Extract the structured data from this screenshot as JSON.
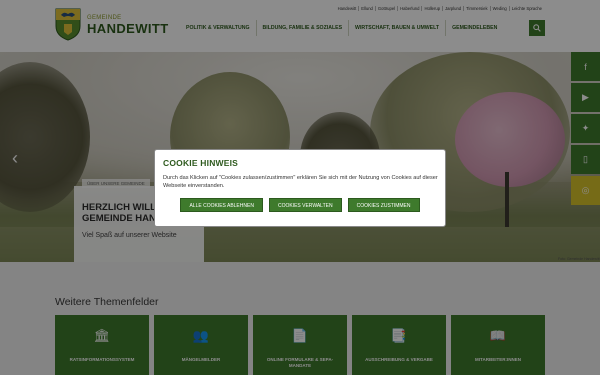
{
  "header": {
    "logo_small": "GEMEINDE",
    "logo_big": "HANDEWITT",
    "quicklinks": [
      "Handewitt",
      "Ellund",
      "Gottrupel",
      "Haberlund",
      "Hüllerup",
      "Jarplund",
      "Timmersiek",
      "Weding",
      "Leichte Sprache"
    ],
    "nav": [
      "POLITIK & VERWALTUNG",
      "BILDUNG, FAMILIE & SOZIALES",
      "WIRTSCHAFT, BAUEN & UMWELT",
      "GEMEINDELEBEN"
    ],
    "search_icon": "search-icon"
  },
  "hero": {
    "tag": "ÜBER UNSERE GEMEINDE",
    "title": "HERZLICH WILLKOMMEN IN DER GEMEINDE HANDEWITT",
    "subtitle": "Viel Spaß auf unserer Website",
    "photo_credit": "Foto: Gemeinde Handewitt",
    "prev_icon": "chevron-left-icon"
  },
  "social": [
    {
      "icon": "facebook-icon",
      "glyph": "f"
    },
    {
      "icon": "youtube-icon",
      "glyph": "▶"
    },
    {
      "icon": "twitter-icon",
      "glyph": "✦"
    },
    {
      "icon": "phone-icon",
      "glyph": "▯"
    },
    {
      "icon": "app-icon",
      "glyph": "◎"
    }
  ],
  "cookie": {
    "title": "COOKIE HINWEIS",
    "text": "Durch das Klicken auf \"Cookies zulassen/zustimmen\" erklären Sie sich mit der Nutzung von Cookies auf dieser Webseite einverstanden.",
    "btn_reject": "ALLE COOKIES ABLEHNEN",
    "btn_manage": "COOKIES VERWALTEN",
    "btn_accept": "COOKIES ZUSTIMMEN"
  },
  "themes": {
    "title": "Weitere Themenfelder",
    "tiles": [
      {
        "label": "RATSINFORMATIONSSYSTEM",
        "icon": "bank-icon",
        "glyph": "🏛"
      },
      {
        "label": "MÄNGELMELDER",
        "icon": "people-icon",
        "glyph": "👥"
      },
      {
        "label": "ONLINE FORMULARE & SEPA-MANDATE",
        "icon": "document-icon",
        "glyph": "📄"
      },
      {
        "label": "AUSSCHREIBUNG & VERGABE",
        "icon": "file-icon",
        "glyph": "📑"
      },
      {
        "label": "MITARBEITER:INNEN",
        "icon": "book-icon",
        "glyph": "📖"
      }
    ]
  },
  "colors": {
    "brand_green": "#3e7a2c",
    "accent_yellow": "#d8c32b"
  }
}
